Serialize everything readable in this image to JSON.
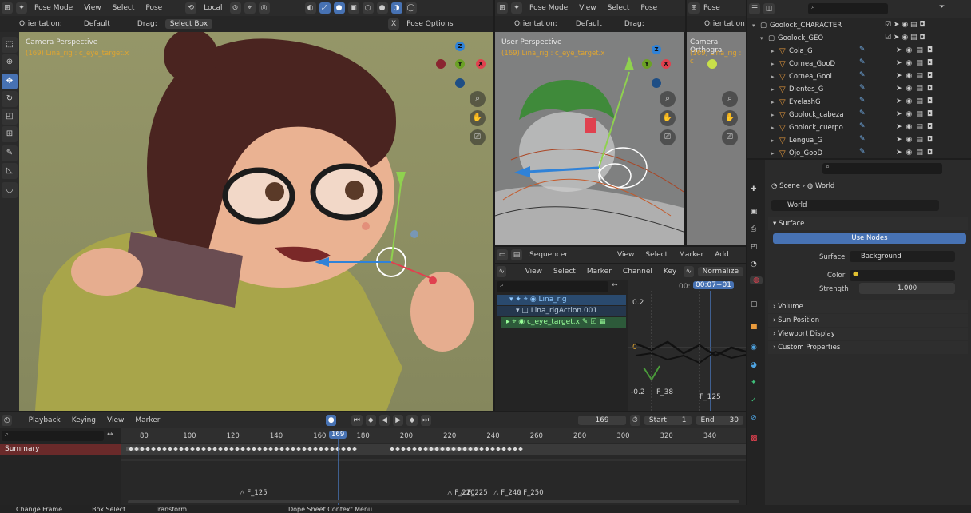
{
  "main_viewport": {
    "header": {
      "mode": "Pose Mode",
      "menus": [
        "View",
        "Select",
        "Pose"
      ],
      "transform_space": "Local"
    },
    "orientation_label": "Orientation:",
    "orientation_value": "Default",
    "drag_label": "Drag:",
    "drag_value": "Select Box",
    "pose_options": "Pose Options",
    "x_label": "X",
    "view_name": "Camera Perspective",
    "object_name": "(169) Lina_rig : c_eye_target.x"
  },
  "right_viewport": {
    "header": {
      "mode": "Pose Mode",
      "menus": [
        "View",
        "Select",
        "Pose"
      ]
    },
    "orientation_label": "Orientation:",
    "orientation_value": "Default",
    "drag_label": "Drag:",
    "view_name": "User Perspective",
    "object_name": "(169) Lina_rig : c_eye_target.x"
  },
  "far_viewport": {
    "header_mode": "Pose",
    "orientation_label": "Orientation",
    "view_name": "Camera Orthogra",
    "object_name": "(169) Lina_rig : c"
  },
  "gizmo_labels": {
    "z": "Z",
    "y": "Y",
    "x": "X"
  },
  "sequencer": {
    "editor_name": "Sequencer",
    "menus": [
      "View",
      "Select",
      "Marker",
      "Add"
    ]
  },
  "graph_editor": {
    "menus": [
      "View",
      "Select",
      "Marker",
      "Channel",
      "Key"
    ],
    "normalize": "Normalize",
    "current_time": "00:07+01",
    "time_prefix": "00:",
    "channels": [
      {
        "label": "Lina_rig"
      },
      {
        "label": "Lina_rigAction.001"
      },
      {
        "label": "c_eye_target.x"
      }
    ],
    "y_labels": [
      "0.2",
      "0",
      "-0.2"
    ],
    "markers": [
      "F_38",
      "F_125"
    ]
  },
  "outliner": {
    "collections": [
      {
        "label": "Goolock_CHARACTER"
      },
      {
        "label": "Goolock_GEO"
      }
    ],
    "items": [
      "Cola_G",
      "Cornea_GooD",
      "Cornea_Gool",
      "Dientes_G",
      "EyelashG",
      "Goolock_cabeza",
      "Goolock_cuerpo",
      "Lengua_G",
      "Ojo_GooD"
    ]
  },
  "properties": {
    "breadcrumb_scene": "Scene",
    "breadcrumb_world": "World",
    "world_name": "World",
    "surface_section": "Surface",
    "use_nodes": "Use Nodes",
    "surface_label": "Surface",
    "surface_value": "Background",
    "color_label": "Color",
    "strength_label": "Strength",
    "strength_value": "1.000",
    "sections": [
      "Volume",
      "Sun Position",
      "Viewport Display",
      "Custom Properties"
    ]
  },
  "timeline": {
    "menus": [
      "Playback",
      "Keying",
      "View",
      "Marker"
    ],
    "current_frame": "169",
    "start_label": "Start",
    "start_value": "1",
    "end_label": "End",
    "end_value": "30",
    "frame_numbers": [
      "80",
      "100",
      "120",
      "140",
      "160",
      "180",
      "200",
      "220",
      "240",
      "260",
      "280",
      "300",
      "320",
      "340"
    ],
    "playhead_label": "169",
    "summary_label": "Summary",
    "markers": [
      "F_125",
      "F_220",
      "F_225",
      "F_240",
      "F_250"
    ]
  },
  "status_bar": {
    "items": [
      "Change Frame",
      "Box Select",
      "Transform",
      "Dope Sheet Context Menu"
    ]
  },
  "colors": {
    "accent": "#4772b3",
    "axis_x": "#e0414f",
    "axis_y": "#6ba125",
    "axis_z": "#2f82d8",
    "object_orange": "#e89a3c",
    "bg_main": "#8e9064"
  },
  "icons": [
    "pose-mode-icon",
    "cursor-tool-icon",
    "move-tool-icon",
    "rotate-tool-icon",
    "scale-tool-icon",
    "transform-tool-icon",
    "annotate-tool-icon",
    "measure-tool-icon",
    "zoom-icon",
    "hand-pan-icon",
    "camera-icon",
    "eye-icon",
    "filter-icon",
    "search-icon",
    "world-icon",
    "scene-icon"
  ]
}
